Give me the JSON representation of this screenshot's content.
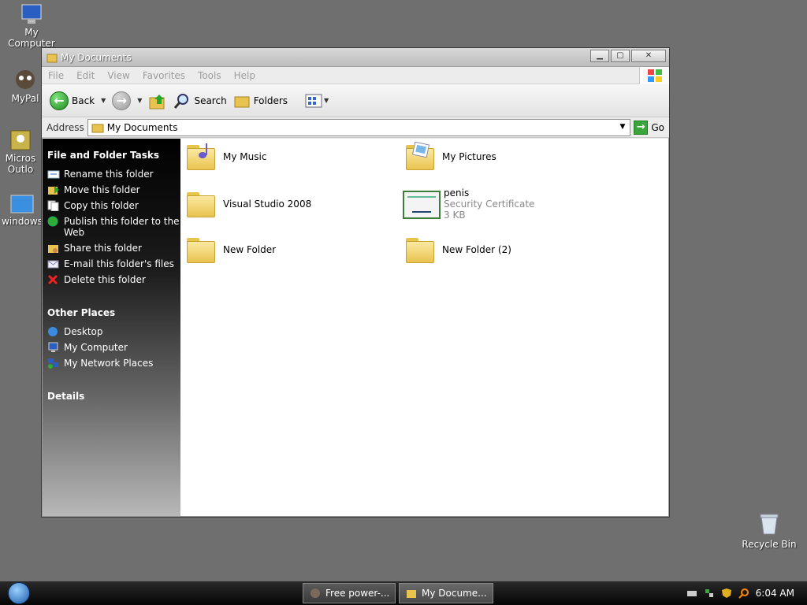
{
  "desktop": {
    "icons": [
      {
        "label": "My Computer"
      },
      {
        "label": "MyPal"
      },
      {
        "label": "Micros\nOutlo"
      },
      {
        "label": "windows"
      }
    ],
    "recycle_bin": "Recycle Bin"
  },
  "window": {
    "title": "My Documents",
    "menu": [
      "File",
      "Edit",
      "View",
      "Favorites",
      "Tools",
      "Help"
    ],
    "toolbar": {
      "back": "Back",
      "search": "Search",
      "folders": "Folders"
    },
    "address": {
      "label": "Address",
      "value": "My Documents",
      "go": "Go"
    },
    "taskpane": {
      "file_folder_tasks": {
        "heading": "File and Folder Tasks",
        "items": [
          "Rename this folder",
          "Move this folder",
          "Copy this folder",
          "Publish this folder to the Web",
          "Share this folder",
          "E-mail this folder's files",
          "Delete this folder"
        ]
      },
      "other_places": {
        "heading": "Other Places",
        "items": [
          "Desktop",
          "My Computer",
          "My Network Places"
        ]
      },
      "details": {
        "heading": "Details"
      }
    },
    "files": [
      {
        "name": "My Music",
        "type": "folder-music"
      },
      {
        "name": "My Pictures",
        "type": "folder-pictures"
      },
      {
        "name": "Visual Studio 2008",
        "type": "folder"
      },
      {
        "name": "penis",
        "type": "certificate",
        "subtitle": "Security Certificate",
        "size": "3 KB"
      },
      {
        "name": "New Folder",
        "type": "folder"
      },
      {
        "name": "New Folder (2)",
        "type": "folder"
      }
    ]
  },
  "taskbar": {
    "buttons": [
      "Free power-...",
      "My Docume..."
    ],
    "clock": "6:04 AM"
  },
  "colors": {
    "desktop": "#6f6f6f",
    "taskpane_top": "#000000",
    "go_green": "#3aa53a"
  }
}
